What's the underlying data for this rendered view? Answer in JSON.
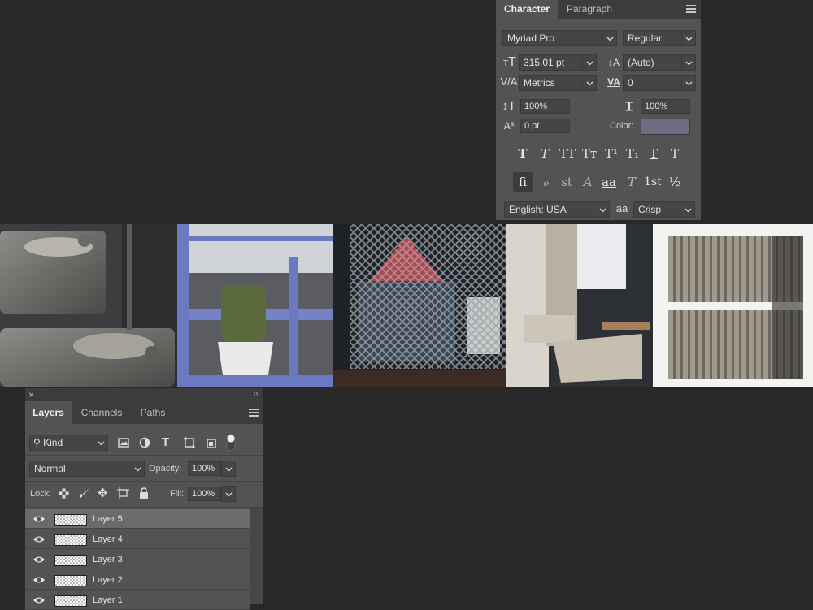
{
  "character_panel": {
    "tabs": [
      "Character",
      "Paragraph"
    ],
    "font_family": "Myriad Pro",
    "font_style": "Regular",
    "font_size": "315.01 pt",
    "leading": "(Auto)",
    "kerning": "Metrics",
    "tracking": "0",
    "vertical_scale": "100%",
    "horizontal_scale": "100%",
    "baseline_shift": "0 pt",
    "color_label": "Color:",
    "color_value": "#6f6b82",
    "style_buttons": [
      "T",
      "T",
      "TT",
      "Tт",
      "T¹",
      "T₁",
      "T",
      "T"
    ],
    "opentype_buttons": [
      "fi",
      "ℴ",
      "st",
      "A",
      "aa",
      "T",
      "1st",
      "½"
    ],
    "language": "English: USA",
    "antialias_icon": "aa",
    "antialias": "Crisp"
  },
  "layers_panel": {
    "tabs": [
      "Layers",
      "Channels",
      "Paths"
    ],
    "filter_kind": "Kind",
    "blend_mode": "Normal",
    "opacity_label": "Opacity:",
    "opacity": "100%",
    "lock_label": "Lock:",
    "fill_label": "Fill:",
    "fill": "100%",
    "layers": [
      {
        "name": "Layer 5",
        "selected": true
      },
      {
        "name": "Layer 4",
        "selected": false
      },
      {
        "name": "Layer 3",
        "selected": false
      },
      {
        "name": "Layer 2",
        "selected": false
      },
      {
        "name": "Layer 1",
        "selected": false
      }
    ]
  },
  "colors": {
    "background": "#282828",
    "panel": "#535353",
    "panel_dark": "#3c3c3c",
    "selected_layer": "#6b6b6b"
  }
}
